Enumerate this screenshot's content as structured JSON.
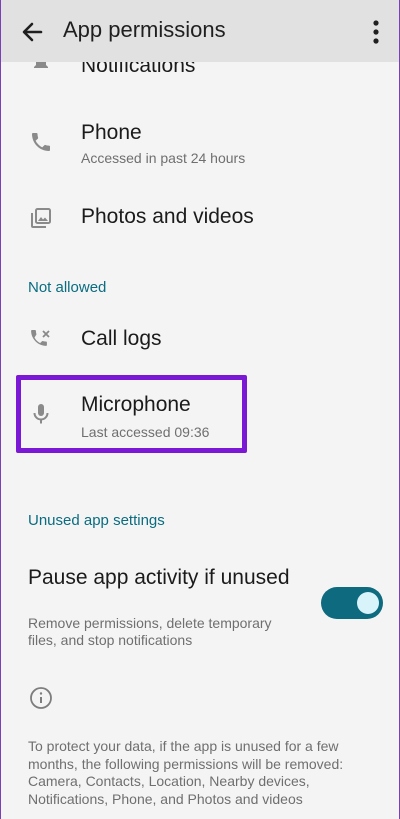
{
  "app_bar": {
    "title": "App permissions",
    "back_icon": "arrow-back-icon",
    "menu_icon": "more-vert-icon"
  },
  "allowed": [
    {
      "title": "Notifications",
      "subtitle": "",
      "icon": "bell-icon"
    },
    {
      "title": "Phone",
      "subtitle": "Accessed in past 24 hours",
      "icon": "phone-icon"
    },
    {
      "title": "Photos and videos",
      "subtitle": "",
      "icon": "photos-icon"
    }
  ],
  "not_allowed": {
    "header": "Not allowed",
    "items": [
      {
        "title": "Call logs",
        "subtitle": "",
        "icon": "call-log-icon"
      },
      {
        "title": "Microphone",
        "subtitle": "Last accessed 09:36",
        "icon": "microphone-icon"
      }
    ]
  },
  "unused": {
    "header": "Unused app settings",
    "pause_title": "Pause app activity if unused",
    "pause_subtitle": "Remove permissions, delete temporary files, and stop notifications",
    "toggle_on": true,
    "info_icon": "info-icon",
    "footer": "To protect your data, if the app is unused for a few months, the following permissions will be removed: Camera, Contacts, Location, Nearby devices, Notifications, Phone, and Photos and videos"
  },
  "colors": {
    "accent": "#0e6a7e",
    "highlight": "#7a18d6",
    "appbar_bg": "#e1e1e1",
    "page_bg": "#f4f4f4"
  }
}
